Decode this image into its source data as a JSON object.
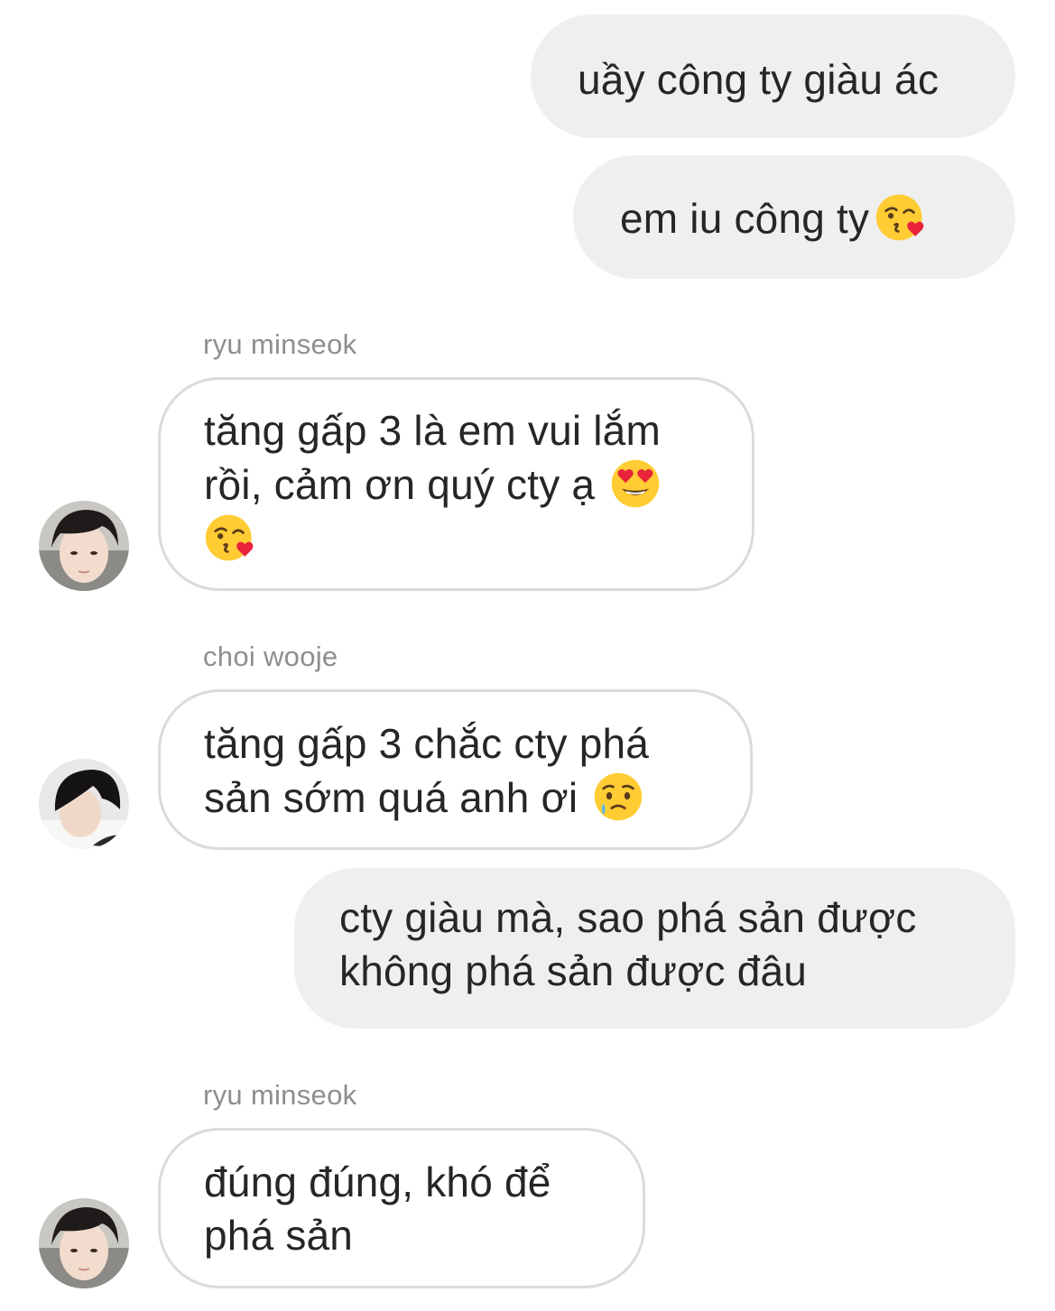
{
  "messages": [
    {
      "direction": "outgoing",
      "lines": [
        "uầy công ty giàu ác"
      ]
    },
    {
      "direction": "outgoing",
      "lines": [
        "em iu công ty"
      ],
      "trailing_emoji": "face-blowing-kiss"
    },
    {
      "direction": "incoming",
      "sender": "ryu minseok",
      "lines": [
        "tăng gấp 3 là em vui lắm",
        "rồi, cảm ơn quý cty ạ"
      ],
      "emojis": [
        "smiling-face-with-heart-eyes",
        "face-blowing-kiss"
      ]
    },
    {
      "direction": "incoming",
      "sender": "choi wooje",
      "lines": [
        "tăng gấp 3 chắc cty phá",
        "sản sớm quá anh ơi"
      ],
      "trailing_emoji": "face-holding-back-tears"
    },
    {
      "direction": "outgoing",
      "lines": [
        "cty giàu mà, sao phá sản được",
        "không phá sản được đâu"
      ]
    },
    {
      "direction": "incoming",
      "sender": "ryu minseok",
      "lines": [
        "đúng đúng, khó để",
        "phá sản"
      ]
    }
  ],
  "avatars": [
    {
      "user": "ryu minseok",
      "icon": "user-avatar-photo"
    },
    {
      "user": "choi wooje",
      "icon": "user-avatar-photo"
    },
    {
      "user": "ryu minseok",
      "icon": "user-avatar-photo"
    }
  ],
  "colors": {
    "outgoing_bubble": "#efefef",
    "incoming_border": "#dbdbdb",
    "text": "#262626",
    "sender_name": "#8e8e8e"
  }
}
